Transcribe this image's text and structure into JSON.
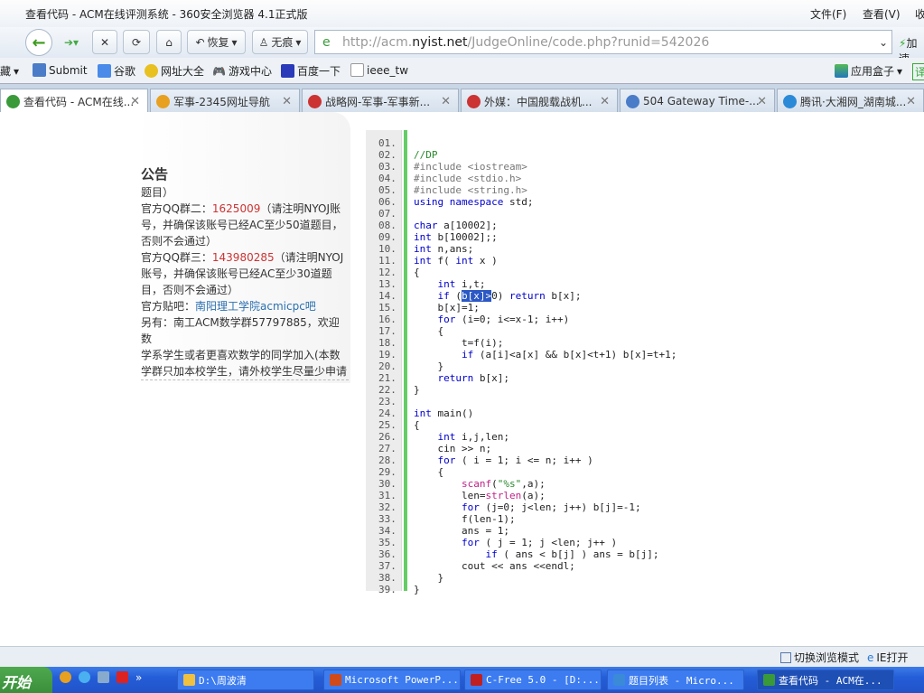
{
  "window": {
    "title": "查看代码 - ACM在线评测系统 - 360安全浏览器 4.1正式版",
    "menu": [
      "文件(F)",
      "查看(V)",
      "收"
    ]
  },
  "toolbar": {
    "restore": "恢复",
    "private": "无痕",
    "url_host_prefix": "http://acm.",
    "url_host": "nyist.net",
    "url_path": "/JudgeOnline/code.php?runid=542026",
    "speedup": "加速"
  },
  "bookmarks": {
    "left_cut": "藏",
    "items": [
      "Submit",
      "谷歌",
      "网址大全",
      "游戏中心",
      "百度一下",
      "ieee_tw"
    ],
    "appbox": "应用盒子",
    "translate": "译"
  },
  "tabs": [
    {
      "label": "查看代码 - ACM在线...",
      "icon": "ie-icon",
      "color": "#3a9a3a",
      "active": true
    },
    {
      "label": "军事-2345网址导航",
      "icon": "site-2345-icon",
      "color": "#e8a020"
    },
    {
      "label": "战略网-军事-军事新...",
      "icon": "chinaiiss-icon",
      "color": "#c33"
    },
    {
      "label": "外媒：中国舰载战机...",
      "icon": "chinaiiss-icon",
      "color": "#c33"
    },
    {
      "label": "504 Gateway Time-...",
      "icon": "poj-icon",
      "color": "#4a7cc8"
    },
    {
      "label": "腾讯·大湘网_湖南城...",
      "icon": "qq-icon",
      "color": "#2a8ad8"
    }
  ],
  "sidebar": {
    "title": "公告",
    "lines": [
      {
        "parts": [
          {
            "t": "题目）"
          }
        ]
      },
      {
        "parts": [
          {
            "t": "官方QQ群二："
          },
          {
            "t": "1625009",
            "c": "red"
          },
          {
            "t": "（请注明NYOJ账"
          }
        ]
      },
      {
        "parts": [
          {
            "t": "号，并确保该账号已经AC至少50道题目，"
          }
        ]
      },
      {
        "parts": [
          {
            "t": "否则不会通过）"
          }
        ]
      },
      {
        "parts": [
          {
            "t": "官方QQ群三："
          },
          {
            "t": "143980285",
            "c": "red"
          },
          {
            "t": "（请注明NYOJ"
          }
        ]
      },
      {
        "parts": [
          {
            "t": "账号，并确保该账号已经AC至少30道题"
          }
        ]
      },
      {
        "parts": [
          {
            "t": "目，否则不会通过）"
          }
        ]
      },
      {
        "parts": [
          {
            "t": "官方贴吧："
          },
          {
            "t": "南阳理工学院acmicpc吧",
            "c": "link"
          }
        ]
      },
      {
        "parts": [
          {
            "t": "另有：南工ACM数学群57797885，欢迎数"
          }
        ]
      },
      {
        "parts": [
          {
            "t": "学系学生或者更喜欢数学的同学加入(本数"
          }
        ]
      },
      {
        "parts": [
          {
            "t": "学群只加本校学生，请外校学生尽量少申请"
          }
        ]
      }
    ]
  },
  "code": {
    "lines": [
      "",
      "//DP",
      "#include <iostream>",
      "#include <stdio.h>",
      "#include <string.h>",
      "using namespace std;",
      "",
      "char a[10002];",
      "int b[10002];;",
      "int n,ans;",
      "int f( int x )",
      "{",
      "    int i,t;",
      "    if (b[x]>0) return b[x];",
      "    b[x]=1;",
      "    for (i=0; i<=x-1; i++)",
      "    {",
      "        t=f(i);",
      "        if (a[i]<a[x] && b[x]<t+1) b[x]=t+1;",
      "    }",
      "    return b[x];",
      "}",
      "",
      "int main()",
      "{",
      "    int i,j,len;",
      "    cin >> n;",
      "    for ( i = 1; i <= n; i++ )",
      "    {",
      "        scanf(\"%s\",a);",
      "        len=strlen(a);",
      "        for (j=0; j<len; j++) b[j]=-1;",
      "        f(len-1);",
      "        ans = 1;",
      "        for ( j = 1; j <len; j++ )",
      "            if ( ans < b[j] ) ans = b[j];",
      "        cout << ans <<endl;",
      "    }",
      "}"
    ],
    "selected_text": "b[x]>"
  },
  "statusbar": {
    "switch_mode": "切换浏览模式",
    "ie_open": "IE打开"
  },
  "taskbar": {
    "start": "开始",
    "tasks": [
      {
        "label": "D:\\周波清",
        "color": "#f0c040"
      },
      {
        "label": "Microsoft PowerP...",
        "color": "#d04a1a"
      },
      {
        "label": "C-Free 5.0 - [D:...",
        "color": "#c02020"
      },
      {
        "label": "题目列表 - Micro...",
        "color": "#3a8ad8"
      },
      {
        "label": "查看代码 - ACM在...",
        "color": "#3a9a3a",
        "active": true
      }
    ]
  }
}
